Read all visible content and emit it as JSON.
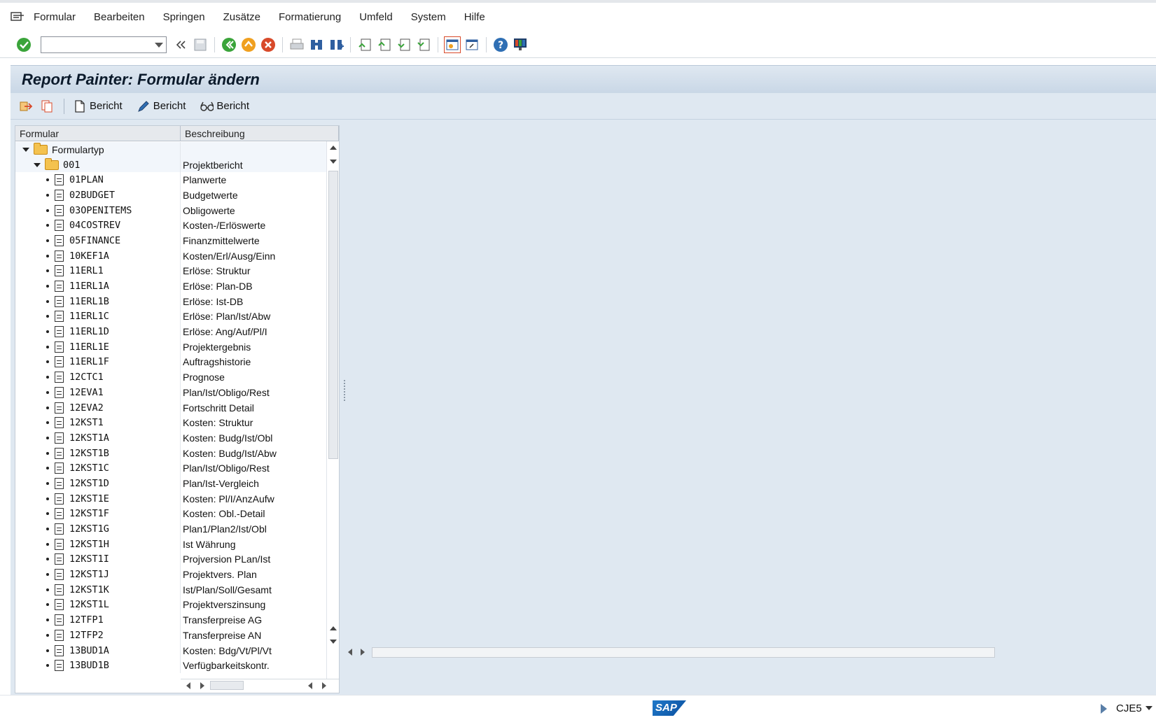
{
  "menu": {
    "items": [
      {
        "label": "Formular"
      },
      {
        "label": "Bearbeiten"
      },
      {
        "label": "Springen"
      },
      {
        "label": "Zusätze"
      },
      {
        "label": "Formatierung"
      },
      {
        "label": "Umfeld"
      },
      {
        "label": "System"
      },
      {
        "label": "Hilfe"
      }
    ]
  },
  "toolbar": {
    "command_field_value": ""
  },
  "title": "Report Painter: Formular ändern",
  "app_toolbar": {
    "buttons": [
      {
        "label": "Bericht",
        "icon": "document-icon"
      },
      {
        "label": "Bericht",
        "icon": "pencil-icon"
      },
      {
        "label": "Bericht",
        "icon": "glasses-icon"
      }
    ]
  },
  "tree": {
    "headers": [
      "Formular",
      "Beschreibung"
    ],
    "root": {
      "label": "Formulartyp"
    },
    "folder": {
      "label": "001",
      "desc": "Projektbericht"
    },
    "items": [
      {
        "name": "01PLAN",
        "desc": "Planwerte"
      },
      {
        "name": "02BUDGET",
        "desc": "Budgetwerte"
      },
      {
        "name": "03OPENITEMS",
        "desc": "Obligowerte"
      },
      {
        "name": "04COSTREV",
        "desc": "Kosten-/Erlöswerte"
      },
      {
        "name": "05FINANCE",
        "desc": "Finanzmittelwerte"
      },
      {
        "name": "10KEF1A",
        "desc": "Kosten/Erl/Ausg/Einn"
      },
      {
        "name": "11ERL1",
        "desc": "Erlöse: Struktur"
      },
      {
        "name": "11ERL1A",
        "desc": "Erlöse: Plan-DB"
      },
      {
        "name": "11ERL1B",
        "desc": "Erlöse: Ist-DB"
      },
      {
        "name": "11ERL1C",
        "desc": "Erlöse: Plan/Ist/Abw"
      },
      {
        "name": "11ERL1D",
        "desc": "Erlöse: Ang/Auf/Pl/I"
      },
      {
        "name": "11ERL1E",
        "desc": "Projektergebnis"
      },
      {
        "name": "11ERL1F",
        "desc": "Auftragshistorie"
      },
      {
        "name": "12CTC1",
        "desc": "Prognose"
      },
      {
        "name": "12EVA1",
        "desc": "Plan/Ist/Obligo/Rest"
      },
      {
        "name": "12EVA2",
        "desc": "Fortschritt Detail"
      },
      {
        "name": "12KST1",
        "desc": "Kosten: Struktur"
      },
      {
        "name": "12KST1A",
        "desc": "Kosten: Budg/Ist/Obl"
      },
      {
        "name": "12KST1B",
        "desc": "Kosten: Budg/Ist/Abw"
      },
      {
        "name": "12KST1C",
        "desc": "Plan/Ist/Obligo/Rest"
      },
      {
        "name": "12KST1D",
        "desc": "Plan/Ist-Vergleich"
      },
      {
        "name": "12KST1E",
        "desc": "Kosten: Pl/I/AnzAufw"
      },
      {
        "name": "12KST1F",
        "desc": "Kosten: Obl.-Detail"
      },
      {
        "name": "12KST1G",
        "desc": "Plan1/Plan2/Ist/Obl"
      },
      {
        "name": "12KST1H",
        "desc": "Ist Währung"
      },
      {
        "name": "12KST1I",
        "desc": "Projversion PLan/Ist"
      },
      {
        "name": "12KST1J",
        "desc": "Projektvers. Plan"
      },
      {
        "name": "12KST1K",
        "desc": "Ist/Plan/Soll/Gesamt"
      },
      {
        "name": "12KST1L",
        "desc": "Projektverszinsung"
      },
      {
        "name": "12TFP1",
        "desc": "Transferpreise AG"
      },
      {
        "name": "12TFP2",
        "desc": "Transferpreise AN"
      },
      {
        "name": "13BUD1A",
        "desc": "Kosten: Bdg/Vt/Pl/Vt"
      },
      {
        "name": "13BUD1B",
        "desc": "Verfügbarkeitskontr."
      }
    ]
  },
  "status": {
    "logo": "SAP",
    "tcode": "CJE5"
  },
  "colors": {
    "title_bg": "#dfe8f1",
    "folder": "#f4c24f",
    "check_green": "#3aa43a",
    "nav_orange": "#f0a020",
    "cancel_red": "#d84a2a"
  }
}
